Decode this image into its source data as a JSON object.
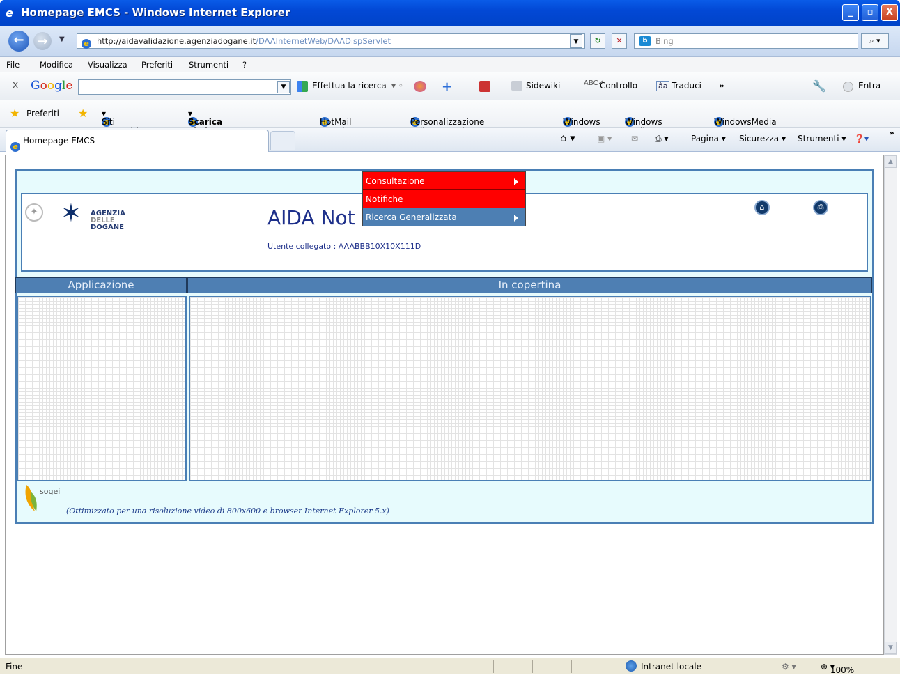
{
  "window": {
    "title": "Homepage EMCS - Windows Internet Explorer",
    "minimize": "_",
    "maximize": "▫",
    "close": "X"
  },
  "address": {
    "url_host": "http://aidavalidazione.agenziadogane.it",
    "url_path": "/DAAInternetWeb/DAADispServlet",
    "search_placeholder": "Bing"
  },
  "menubar": [
    "File",
    "Modifica",
    "Visualizza",
    "Preferiti",
    "Strumenti",
    "?"
  ],
  "google_toolbar": {
    "close": "x",
    "logo": "Google",
    "search_label": "Effettua la ricerca",
    "sidewiki": "Sidewiki",
    "controllo": "Controllo",
    "traduci": "Traduci",
    "more": "»",
    "entra": "Entra"
  },
  "favorites": {
    "preferiti": "Preferiti",
    "items": [
      "Siti suggeriti",
      "Scarica altri add-on",
      "HotMail gratuita",
      "Personalizzazione collegamenti",
      "Windows",
      "Windows Media",
      "WindowsMedia"
    ]
  },
  "tabs": {
    "active": "Homepage EMCS",
    "commands": [
      "Pagina",
      "Sicurezza",
      "Strumenti"
    ],
    "more": "»"
  },
  "page": {
    "logo_text": [
      "AGENZIA",
      "DELLE",
      "DOGANE"
    ],
    "title": "AIDA Not",
    "user": "Utente collegato : AAABBB10X10X111D",
    "col_app": "Applicazione",
    "col_cover": "In copertina",
    "sogei": "sogei",
    "footer": "(Ottimizzato per una risoluzione video di 800x600 e browser Internet Explorer 5.x)"
  },
  "dropdown": {
    "items": [
      {
        "label": "Consultazione",
        "submenu": true,
        "color": "#ff0000"
      },
      {
        "label": "Notifiche",
        "submenu": false,
        "color": "#ff0000"
      },
      {
        "label": "Ricerca Generalizzata",
        "submenu": true,
        "color": "#4d7fb3"
      }
    ]
  },
  "status": {
    "left": "Fine",
    "zone": "Intranet locale",
    "zoom": "100%"
  }
}
